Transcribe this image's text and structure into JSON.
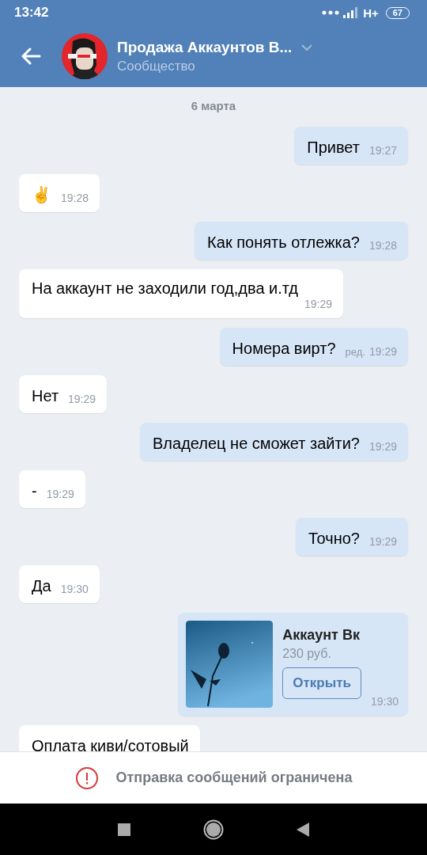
{
  "status_bar": {
    "time": "13:42",
    "network": "H+",
    "battery": "67"
  },
  "header": {
    "title": "Продажа Аккаунтов В...",
    "subtitle": "Сообщество"
  },
  "date": "6 марта",
  "messages": [
    {
      "kind": "text",
      "outgoing": true,
      "text": "Привет",
      "time": "19:27"
    },
    {
      "kind": "text",
      "outgoing": false,
      "text": "✌",
      "time": "19:28"
    },
    {
      "kind": "text",
      "outgoing": true,
      "text": "Как понять отлежка?",
      "time": "19:28"
    },
    {
      "kind": "text",
      "outgoing": false,
      "text": "На аккаунт не заходили год,два и.тд",
      "time": "19:29"
    },
    {
      "kind": "text",
      "outgoing": true,
      "text": "Номера вирт?",
      "edited": "ред.",
      "time": "19:29"
    },
    {
      "kind": "text",
      "outgoing": false,
      "text": "Нет",
      "time": "19:29"
    },
    {
      "kind": "text",
      "outgoing": true,
      "text": "Владелец не сможет зайти?",
      "time": "19:29"
    },
    {
      "kind": "text",
      "outgoing": false,
      "text": "-",
      "time": "19:29"
    },
    {
      "kind": "text",
      "outgoing": true,
      "text": "Точно?",
      "time": "19:29"
    },
    {
      "kind": "text",
      "outgoing": false,
      "text": "Да",
      "time": "19:30"
    },
    {
      "kind": "product",
      "outgoing": true,
      "title": "Аккаунт Вк",
      "price": "230 руб.",
      "button": "Открыть",
      "time": "19:30"
    },
    {
      "kind": "text",
      "outgoing": false,
      "text": "Оплата киви/сотовый"
    }
  ],
  "notice": "Отправка сообщений ограничена"
}
